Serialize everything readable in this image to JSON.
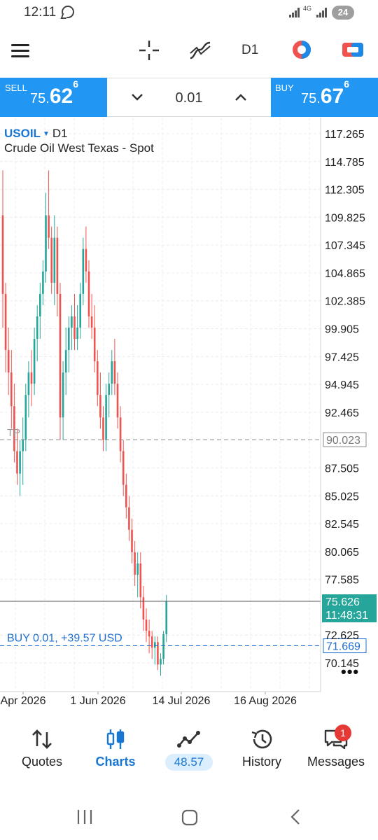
{
  "status_bar": {
    "time": "12:11",
    "network_label": "4G",
    "battery": "24"
  },
  "toolbar": {
    "timeframe": "D1",
    "icons": [
      "menu-icon",
      "crosshair-icon",
      "indicators-icon",
      "timeframe-label",
      "chart-colors-icon",
      "trade-icon"
    ]
  },
  "trade_bar": {
    "sell_label": "SELL",
    "sell_price_small": "75.",
    "sell_price_big": "62",
    "sell_price_sup": "6",
    "buy_label": "BUY",
    "buy_price_small": "75.",
    "buy_price_big": "67",
    "buy_price_sup": "6",
    "lot_value": "0.01"
  },
  "chart": {
    "symbol": "USOIL",
    "timeframe": "D1",
    "description": "Crude Oil West Texas - Spot",
    "tp_label": "TP",
    "tp_price": "90.023",
    "position_label": "BUY 0.01,   +39.57 USD",
    "position_price": "71.669",
    "current_price": "75.626",
    "countdown": "11:48:31",
    "more_label": "•••",
    "colors": {
      "bull": "#26a69a",
      "bear": "#ef5350",
      "accent": "#2196f3",
      "price_tag": "#26a69a"
    }
  },
  "chart_data": {
    "type": "candlestick",
    "symbol": "USOIL",
    "ylim": [
      68.5,
      118.5
    ],
    "y_ticks": [
      "117.265",
      "114.785",
      "112.305",
      "109.825",
      "107.345",
      "104.865",
      "102.385",
      "99.905",
      "97.425",
      "94.945",
      "92.465",
      "90.023",
      "87.505",
      "85.025",
      "82.545",
      "80.065",
      "77.585",
      "75.626",
      "72.625",
      "71.669",
      "70.145"
    ],
    "x_ticks": [
      "Apr 2026",
      "1 Jun 2026",
      "14 Jul 2026",
      "16 Aug 2026"
    ],
    "grid": true,
    "candles": [
      [
        110,
        114,
        100,
        103
      ],
      [
        103,
        104,
        96,
        98
      ],
      [
        98,
        100,
        94,
        96
      ],
      [
        96,
        98,
        91,
        93
      ],
      [
        93,
        95,
        88,
        89
      ],
      [
        89,
        91,
        86,
        87
      ],
      [
        87,
        90,
        85,
        89
      ],
      [
        89,
        92,
        86,
        90
      ],
      [
        90,
        95,
        89,
        94
      ],
      [
        94,
        97,
        92,
        96
      ],
      [
        96,
        98,
        93,
        95
      ],
      [
        95,
        100,
        94,
        99
      ],
      [
        99,
        102,
        97,
        101
      ],
      [
        101,
        104,
        99,
        103
      ],
      [
        103,
        106,
        102,
        105
      ],
      [
        105,
        112,
        104,
        110
      ],
      [
        110,
        114,
        107,
        108
      ],
      [
        108,
        109,
        103,
        104
      ],
      [
        104,
        110,
        102,
        108
      ],
      [
        108,
        109,
        101,
        103
      ],
      [
        103,
        104,
        90,
        92
      ],
      [
        92,
        97,
        90,
        96
      ],
      [
        96,
        100,
        94,
        98
      ],
      [
        98,
        101,
        96,
        100
      ],
      [
        100,
        102,
        98,
        101
      ],
      [
        101,
        103,
        98,
        99
      ],
      [
        99,
        102,
        98,
        100
      ],
      [
        100,
        104,
        99,
        103
      ],
      [
        103,
        108,
        102,
        107
      ],
      [
        107,
        109,
        104,
        105
      ],
      [
        105,
        106,
        100,
        101
      ],
      [
        101,
        103,
        99,
        100
      ],
      [
        100,
        102,
        96,
        97
      ],
      [
        97,
        98,
        93,
        94
      ],
      [
        94,
        96,
        91,
        92
      ],
      [
        92,
        93,
        89,
        90
      ],
      [
        90,
        95,
        89,
        94
      ],
      [
        94,
        96,
        92,
        95
      ],
      [
        95,
        98,
        94,
        97
      ],
      [
        97,
        99,
        94,
        95
      ],
      [
        95,
        96,
        91,
        92
      ],
      [
        92,
        93,
        88,
        89
      ],
      [
        89,
        90,
        85,
        86
      ],
      [
        86,
        87,
        83,
        84
      ],
      [
        84,
        85,
        81,
        82
      ],
      [
        82,
        83,
        79,
        80
      ],
      [
        80,
        81,
        77,
        78
      ],
      [
        78,
        80,
        76,
        79
      ],
      [
        79,
        80,
        75,
        76
      ],
      [
        76,
        77,
        73,
        74
      ],
      [
        74,
        75,
        72,
        73
      ],
      [
        73,
        74,
        71,
        72.5
      ],
      [
        72.5,
        73,
        70.5,
        71.5
      ],
      [
        71.5,
        72.5,
        70,
        72
      ],
      [
        72,
        72.5,
        69.5,
        70
      ],
      [
        70,
        71,
        69,
        70.5
      ],
      [
        70.5,
        73,
        70,
        72.7
      ],
      [
        72.7,
        76.2,
        72,
        75.6
      ]
    ],
    "current_price": 75.626,
    "tp_level": 90.023,
    "position_level": 71.669
  },
  "bottom_nav": {
    "items": [
      {
        "label": "Quotes",
        "icon": "quotes-icon"
      },
      {
        "label": "Charts",
        "icon": "charts-icon"
      },
      {
        "label": "48.57",
        "icon": "trade-icon"
      },
      {
        "label": "History",
        "icon": "history-icon"
      },
      {
        "label": "Messages",
        "icon": "messages-icon"
      }
    ],
    "active": "Charts",
    "messages_badge": "1"
  }
}
